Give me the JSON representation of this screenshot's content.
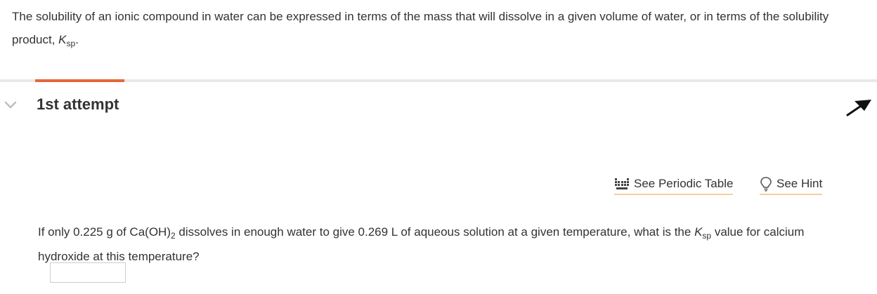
{
  "intro": {
    "text": "The solubility of an ionic compound in water can be expressed in terms of the mass that will dissolve in a given volume of water, or in terms of the solubility product, ",
    "k_symbol": "K",
    "k_subscript": "sp",
    "end_punct": "."
  },
  "attempt": {
    "title": "1st attempt",
    "chevron_icon": "chevron-down-icon",
    "collapse_icon": "arrow-up-right-icon"
  },
  "links": {
    "periodic_table": "See Periodic Table",
    "periodic_icon": "periodic-table-icon",
    "hint": "See Hint",
    "hint_icon": "lightbulb-icon"
  },
  "question": {
    "part1": "If only 0.225 g of Ca(OH)",
    "subscript": "2",
    "part2": " dissolves in enough water to give 0.269 L of aqueous solution at a given temperature, what is the ",
    "k_symbol": "K",
    "k_subscript": "sp",
    "part3": " value for calcium hydroxide at this temperature?"
  },
  "answer": {
    "value": ""
  },
  "colors": {
    "progress": "#e8663c",
    "link_underline": "#f4cf9c",
    "text": "#333333"
  }
}
